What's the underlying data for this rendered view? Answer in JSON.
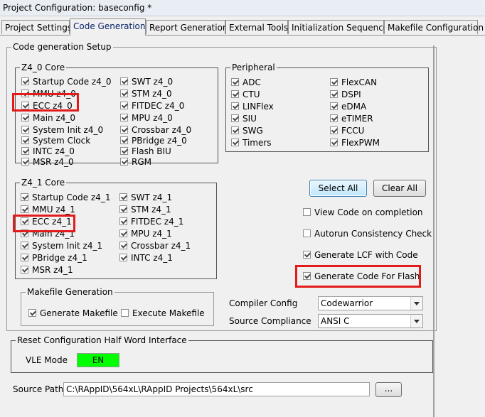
{
  "window": {
    "title": "Project Configuration: baseconfig *"
  },
  "tabs": [
    {
      "label": "Project Settings"
    },
    {
      "label": "Code Generation"
    },
    {
      "label": "Report Generation"
    },
    {
      "label": "External Tools"
    },
    {
      "label": "Initialization Sequence"
    },
    {
      "label": "Makefile Configuration"
    }
  ],
  "code_generation_setup": {
    "legend": "Code generation Setup"
  },
  "z4_0_core": {
    "legend": "Z4_0 Core",
    "col1": [
      {
        "label": "Startup Code z4_0",
        "checked": true
      },
      {
        "label": "MMU z4_0",
        "checked": true
      },
      {
        "label": "ECC z4_0",
        "checked": true
      },
      {
        "label": "Main z4_0",
        "checked": true
      },
      {
        "label": "System Init z4_0",
        "checked": true
      },
      {
        "label": "System Clock",
        "checked": true
      },
      {
        "label": "INTC z4_0",
        "checked": true
      },
      {
        "label": "MSR z4_0",
        "checked": true
      }
    ],
    "col2": [
      {
        "label": "SWT z4_0",
        "checked": true
      },
      {
        "label": "STM z4_0",
        "checked": true
      },
      {
        "label": "FITDEC z4_0",
        "checked": true
      },
      {
        "label": "MPU z4_0",
        "checked": true
      },
      {
        "label": "Crossbar z4_0",
        "checked": true
      },
      {
        "label": "PBridge z4_0",
        "checked": true
      },
      {
        "label": "Flash BIU",
        "checked": true
      },
      {
        "label": "RGM",
        "checked": true
      }
    ]
  },
  "peripheral": {
    "legend": "Peripheral",
    "col1": [
      {
        "label": "ADC",
        "checked": true
      },
      {
        "label": "CTU",
        "checked": true
      },
      {
        "label": "LINFlex",
        "checked": true
      },
      {
        "label": "SIU",
        "checked": true
      },
      {
        "label": "SWG",
        "checked": true
      },
      {
        "label": "Timers",
        "checked": true
      }
    ],
    "col2": [
      {
        "label": "FlexCAN",
        "checked": true
      },
      {
        "label": "DSPI",
        "checked": true
      },
      {
        "label": "eDMA",
        "checked": true
      },
      {
        "label": "eTIMER",
        "checked": true
      },
      {
        "label": "FCCU",
        "checked": true
      },
      {
        "label": "FlexPWM",
        "checked": true
      }
    ]
  },
  "z4_1_core": {
    "legend": "Z4_1 Core",
    "col1": [
      {
        "label": "Startup Code z4_1",
        "checked": true
      },
      {
        "label": "MMU z4_1",
        "checked": true
      },
      {
        "label": "ECC z4_1",
        "checked": true
      },
      {
        "label": "Main z4_1",
        "checked": true
      },
      {
        "label": "System Init z4_1",
        "checked": true
      },
      {
        "label": "PBridge z4_1",
        "checked": true
      },
      {
        "label": "MSR z4_1",
        "checked": true
      }
    ],
    "col2": [
      {
        "label": "SWT z4_1",
        "checked": true
      },
      {
        "label": "STM z4_1",
        "checked": true
      },
      {
        "label": "FITDEC z4_1",
        "checked": true
      },
      {
        "label": "MPU z4_1",
        "checked": true
      },
      {
        "label": "Crossbar z4_1",
        "checked": true
      },
      {
        "label": "INTC z4_1",
        "checked": true
      }
    ]
  },
  "buttons": {
    "select_all": "Select All",
    "clear_all": "Clear All",
    "browse": "..."
  },
  "options": [
    {
      "label": "View Code on completion",
      "checked": false
    },
    {
      "label": "Autorun Consistency Check",
      "checked": false
    },
    {
      "label": "Generate LCF with Code",
      "checked": true
    },
    {
      "label": "Generate Code For Flash",
      "checked": true
    }
  ],
  "makefile_generation": {
    "legend": "Makefile Generation",
    "generate": {
      "label": "Generate Makefile",
      "checked": true
    },
    "execute": {
      "label": "Execute Makefile",
      "checked": false
    }
  },
  "compiler_config": {
    "label": "Compiler Config",
    "value": "Codewarrior"
  },
  "source_compliance": {
    "label": "Source Compliance",
    "value": "ANSI C"
  },
  "reset_config": {
    "legend": "Reset Configuration Half Word Interface",
    "vle_label": "VLE Mode",
    "vle_value": "EN",
    "vle_color": "#00ff00"
  },
  "source_path": {
    "label": "Source Path",
    "value": "C:\\RAppID\\564xL\\RAppID Projects\\564xL\\src"
  },
  "colors": {
    "highlight": "#e41b1b"
  }
}
